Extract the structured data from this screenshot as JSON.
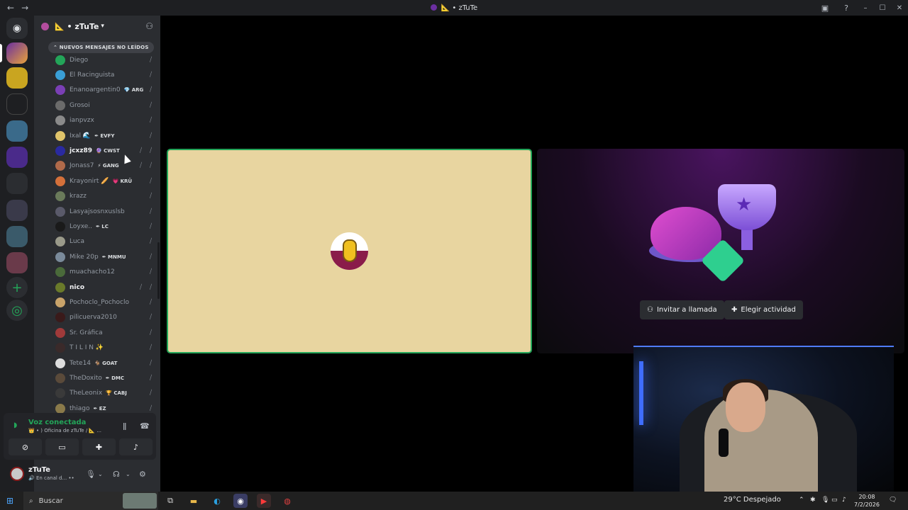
{
  "titlebar": {
    "back": "←",
    "forward": "→",
    "title": "📐 • zTuTe",
    "inbox_icon": "inbox-icon",
    "help_icon": "help-icon",
    "min": "–",
    "max": "☐",
    "close": "✕"
  },
  "server": {
    "name": "📐 • zTuTe",
    "new_messages": "⌃ NUEVOS MENSAJES NO LEÍDOS"
  },
  "members": [
    {
      "name": "Diego",
      "tag": "",
      "color": "#23a559",
      "highlight": false
    },
    {
      "name": "El Racinguista",
      "tag": "",
      "color": "#3a9fd6",
      "highlight": false
    },
    {
      "name": "Enanoargentin0",
      "tag": "💎 ARG",
      "color": "#7a3fb5",
      "highlight": false
    },
    {
      "name": "Grosoi",
      "tag": "",
      "color": "#6b6b6b",
      "highlight": false
    },
    {
      "name": "ianpvzx",
      "tag": "",
      "color": "#8a8a8a",
      "highlight": false
    },
    {
      "name": "Ixal 🌊",
      "tag": "✒ EVFY",
      "color": "#e0c46a",
      "highlight": false
    },
    {
      "name": "jcxz89",
      "tag": "🔮 CWST",
      "color": "#2a2aa0",
      "highlight": true
    },
    {
      "name": "Jonass7",
      "tag": "⚡ GANG",
      "color": "#b06a4a",
      "highlight": false
    },
    {
      "name": "Krayonirt 🥖",
      "tag": "💗 KRÜ",
      "color": "#d4703a",
      "highlight": false
    },
    {
      "name": "krazz",
      "tag": "",
      "color": "#6a7a5a",
      "highlight": false
    },
    {
      "name": "Lasyajsosnxuslsb",
      "tag": "",
      "color": "#5a5a6a",
      "highlight": false
    },
    {
      "name": "Loyxe..",
      "tag": "✒ LC",
      "color": "#1a1a1a",
      "highlight": false
    },
    {
      "name": "Luca",
      "tag": "",
      "color": "#9a9a8a",
      "highlight": false
    },
    {
      "name": "Mike 20p",
      "tag": "✒ MNMU",
      "color": "#7a8a9a",
      "highlight": false
    },
    {
      "name": "muachacho12",
      "tag": "",
      "color": "#4a6a3a",
      "highlight": false
    },
    {
      "name": "nico",
      "tag": "",
      "color": "#6a7a2a",
      "highlight": true
    },
    {
      "name": "Pochoclo_Pochoclo",
      "tag": "",
      "color": "#c9a36a",
      "highlight": false
    },
    {
      "name": "pilicuerva2010",
      "tag": "",
      "color": "#3a1a1a",
      "highlight": false
    },
    {
      "name": "Sr. Gráfica",
      "tag": "",
      "color": "#a03a3a",
      "highlight": false
    },
    {
      "name": "T I L I N ✨",
      "tag": "",
      "color": "#3a2a2a",
      "highlight": false
    },
    {
      "name": "Tete14",
      "tag": "🐐 GOAT",
      "color": "#dddddd",
      "highlight": false
    },
    {
      "name": "TheDoxito",
      "tag": "✒ DMC",
      "color": "#5a4a3a",
      "highlight": false
    },
    {
      "name": "TheLeonix",
      "tag": "🏆 CABJ",
      "color": "#3a3a3a",
      "highlight": false
    },
    {
      "name": "thiago",
      "tag": "✒ EZ",
      "color": "#8a7a4a",
      "highlight": false
    }
  ],
  "voice": {
    "status": "Voz conectada",
    "channel": "👑 • ) Oficina de zTuTe / 📐 ...",
    "icons": [
      "noise-suppression-icon",
      "disconnect-icon",
      "camera-off-icon",
      "screen-share-icon",
      "activities-icon",
      "soundboard-icon"
    ]
  },
  "user": {
    "name": "zTuTe",
    "status": "🔊 En canal d... ••"
  },
  "stage": {
    "invite_label": "Invitar a llamada",
    "activity_label": "Elegir actividad"
  },
  "taskbar": {
    "search_label": "Buscar",
    "weather": "29°C  Despejado",
    "time": "20:08",
    "date": "7/2/2026"
  },
  "colors": {
    "speaking_ring": "#23a559",
    "tile_bg": "#e8d5a0",
    "accent": "#5865f2"
  }
}
